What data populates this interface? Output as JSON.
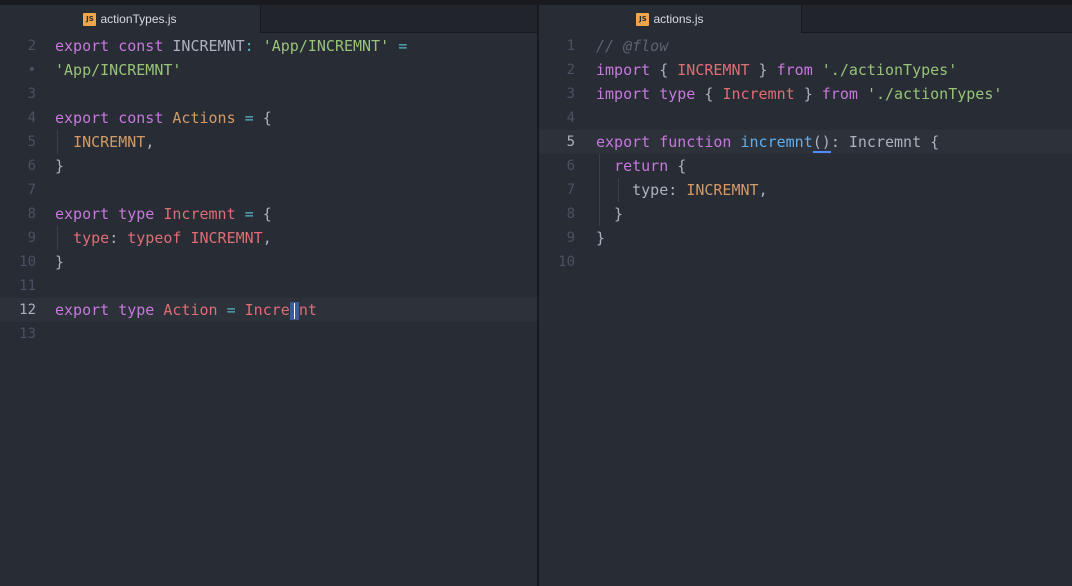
{
  "left_pane": {
    "tab": {
      "icon": "JS",
      "label": "actionTypes.js"
    },
    "lines": [
      {
        "num": "2",
        "tokens": [
          [
            "kw",
            "export"
          ],
          [
            "pl",
            " "
          ],
          [
            "kw",
            "const"
          ],
          [
            "pl",
            " INCREMNT"
          ],
          [
            "op",
            ":"
          ],
          [
            "pl",
            " "
          ],
          [
            "st",
            "'App/INCREMNT'"
          ],
          [
            "pl",
            " "
          ],
          [
            "op",
            "="
          ]
        ]
      },
      {
        "num": "•",
        "tokens": [
          [
            "st",
            "'App/INCREMNT'"
          ]
        ]
      },
      {
        "num": "3",
        "tokens": []
      },
      {
        "num": "4",
        "tokens": [
          [
            "kw",
            "export"
          ],
          [
            "pl",
            " "
          ],
          [
            "kw",
            "const"
          ],
          [
            "pl",
            " "
          ],
          [
            "cn",
            "Actions"
          ],
          [
            "pl",
            " "
          ],
          [
            "op",
            "="
          ],
          [
            "pl",
            " {"
          ]
        ]
      },
      {
        "num": "5",
        "tokens": [
          [
            "pl",
            "  "
          ],
          [
            "cn",
            "INCREMNT"
          ],
          [
            "pl",
            ","
          ]
        ]
      },
      {
        "num": "6",
        "tokens": [
          [
            "pl",
            "}"
          ]
        ]
      },
      {
        "num": "7",
        "tokens": []
      },
      {
        "num": "8",
        "tokens": [
          [
            "kw",
            "export"
          ],
          [
            "pl",
            " "
          ],
          [
            "kw",
            "type"
          ],
          [
            "pl",
            " "
          ],
          [
            "ty",
            "Incremnt"
          ],
          [
            "pl",
            " "
          ],
          [
            "op",
            "="
          ],
          [
            "pl",
            " {"
          ]
        ]
      },
      {
        "num": "9",
        "tokens": [
          [
            "pl",
            "  "
          ],
          [
            "ty",
            "type"
          ],
          [
            "pl",
            ": "
          ],
          [
            "ty",
            "typeof"
          ],
          [
            "pl",
            " "
          ],
          [
            "ty",
            "INCREMNT"
          ],
          [
            "pl",
            ","
          ]
        ]
      },
      {
        "num": "10",
        "tokens": [
          [
            "pl",
            "}"
          ]
        ]
      },
      {
        "num": "11",
        "tokens": []
      },
      {
        "num": "12",
        "tokens": [
          [
            "kw",
            "export"
          ],
          [
            "pl",
            " "
          ],
          [
            "kw",
            "type"
          ],
          [
            "pl",
            " "
          ],
          [
            "ty",
            "Action"
          ],
          [
            "pl",
            " "
          ],
          [
            "op",
            "="
          ],
          [
            "pl",
            " "
          ],
          [
            "ty",
            "Incre"
          ],
          [
            "cursor",
            ""
          ],
          [
            "ty",
            "nt"
          ]
        ],
        "cursorline": true
      },
      {
        "num": "13",
        "tokens": []
      }
    ]
  },
  "right_pane": {
    "tab": {
      "icon": "JS",
      "label": "actions.js"
    },
    "lines": [
      {
        "num": "1",
        "tokens": [
          [
            "cm",
            "// @flow"
          ]
        ]
      },
      {
        "num": "2",
        "tokens": [
          [
            "kw",
            "import"
          ],
          [
            "pl",
            " { "
          ],
          [
            "ty",
            "INCREMNT"
          ],
          [
            "pl",
            " } "
          ],
          [
            "kw",
            "from"
          ],
          [
            "pl",
            " "
          ],
          [
            "st",
            "'./actionTypes'"
          ]
        ]
      },
      {
        "num": "3",
        "tokens": [
          [
            "kw",
            "import"
          ],
          [
            "pl",
            " "
          ],
          [
            "kw",
            "type"
          ],
          [
            "pl",
            " { "
          ],
          [
            "ty",
            "Incremnt"
          ],
          [
            "pl",
            " } "
          ],
          [
            "kw",
            "from"
          ],
          [
            "pl",
            " "
          ],
          [
            "st",
            "'./actionTypes'"
          ]
        ]
      },
      {
        "num": "4",
        "tokens": []
      },
      {
        "num": "5",
        "tokens": [
          [
            "kw",
            "export"
          ],
          [
            "pl",
            " "
          ],
          [
            "kw",
            "function"
          ],
          [
            "pl",
            " "
          ],
          [
            "fn",
            "incremnt"
          ],
          [
            "match",
            "()"
          ],
          [
            "pl",
            ": Incremnt {"
          ]
        ],
        "cursorline": true
      },
      {
        "num": "6",
        "tokens": [
          [
            "pl",
            "  "
          ],
          [
            "kw",
            "return"
          ],
          [
            "pl",
            " {"
          ]
        ]
      },
      {
        "num": "7",
        "tokens": [
          [
            "pl",
            "    type: "
          ],
          [
            "cn",
            "INCREMNT"
          ],
          [
            "pl",
            ","
          ]
        ]
      },
      {
        "num": "8",
        "tokens": [
          [
            "pl",
            "  }"
          ]
        ]
      },
      {
        "num": "9",
        "tokens": [
          [
            "pl",
            "}"
          ]
        ]
      },
      {
        "num": "10",
        "tokens": []
      }
    ]
  },
  "colors": {
    "background": "#282c34",
    "keyword": "#c678dd",
    "string": "#98c379",
    "constant": "#d19a66",
    "type": "#e06c75",
    "function": "#61afef",
    "comment": "#5c6370"
  }
}
